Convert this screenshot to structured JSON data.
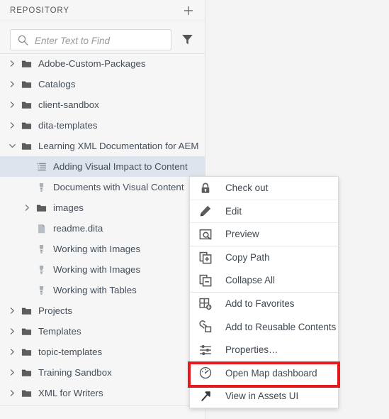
{
  "panel": {
    "title": "REPOSITORY",
    "add_icon": "plus-icon",
    "search": {
      "placeholder": "Enter Text to Find",
      "value": "",
      "icon": "search-icon"
    },
    "filter_icon": "filter-icon"
  },
  "tree": {
    "items": [
      {
        "label": "Adobe-Custom-Packages",
        "icon": "folder-icon",
        "twisty": "collapsed",
        "indent": 0,
        "selected": false
      },
      {
        "label": "Catalogs",
        "icon": "folder-icon",
        "twisty": "collapsed",
        "indent": 0,
        "selected": false
      },
      {
        "label": "client-sandbox",
        "icon": "folder-icon",
        "twisty": "collapsed",
        "indent": 0,
        "selected": false
      },
      {
        "label": "dita-templates",
        "icon": "folder-icon",
        "twisty": "collapsed",
        "indent": 0,
        "selected": false
      },
      {
        "label": "Learning XML Documentation for AEM",
        "icon": "folder-icon",
        "twisty": "expanded",
        "indent": 0,
        "selected": false
      },
      {
        "label": "Adding Visual Impact to Content",
        "icon": "ditamap-icon",
        "twisty": "none",
        "indent": 1,
        "selected": true
      },
      {
        "label": "Documents with Visual Content",
        "icon": "ditatopic-icon",
        "twisty": "none",
        "indent": 1,
        "selected": false
      },
      {
        "label": "images",
        "icon": "folder-icon",
        "twisty": "collapsed",
        "indent": 1,
        "selected": false
      },
      {
        "label": "readme.dita",
        "icon": "file-icon",
        "twisty": "none",
        "indent": 1,
        "selected": false
      },
      {
        "label": "Working with Images",
        "icon": "ditatopic-icon",
        "twisty": "none",
        "indent": 1,
        "selected": false
      },
      {
        "label": "Working with Images",
        "icon": "ditatopic-icon",
        "twisty": "none",
        "indent": 1,
        "selected": false
      },
      {
        "label": "Working with Tables",
        "icon": "ditatopic-icon",
        "twisty": "none",
        "indent": 1,
        "selected": false
      },
      {
        "label": "Projects",
        "icon": "folder-icon",
        "twisty": "collapsed",
        "indent": 0,
        "selected": false
      },
      {
        "label": "Templates",
        "icon": "folder-icon",
        "twisty": "collapsed",
        "indent": 0,
        "selected": false
      },
      {
        "label": "topic-templates",
        "icon": "folder-icon",
        "twisty": "collapsed",
        "indent": 0,
        "selected": false
      },
      {
        "label": "Training Sandbox",
        "icon": "folder-icon",
        "twisty": "collapsed",
        "indent": 0,
        "selected": false
      },
      {
        "label": "XML for Writers",
        "icon": "folder-icon",
        "twisty": "collapsed",
        "indent": 0,
        "selected": false
      }
    ]
  },
  "context_menu": {
    "items": [
      {
        "label": "Check out",
        "icon": "lock-icon",
        "separator_after": true
      },
      {
        "label": "Edit",
        "icon": "pencil-icon",
        "separator_after": true
      },
      {
        "label": "Preview",
        "icon": "preview-icon",
        "separator_after": true,
        "group_end": true
      },
      {
        "label": "Copy Path",
        "icon": "copy-path-icon",
        "separator_after": false
      },
      {
        "label": "Collapse All",
        "icon": "collapse-all-icon",
        "separator_after": false,
        "group_end": true
      },
      {
        "label": "Add to Favorites",
        "icon": "add-favorites-icon",
        "separator_after": false
      },
      {
        "label": "Add to Reusable Contents",
        "icon": "reusable-contents-icon",
        "separator_after": false
      },
      {
        "label": "Properties…",
        "icon": "properties-icon",
        "separator_after": false
      },
      {
        "label": "Open Map dashboard",
        "icon": "dashboard-icon",
        "separator_after": false,
        "highlighted": true
      },
      {
        "label": "View in Assets UI",
        "icon": "external-link-icon",
        "separator_after": false
      }
    ]
  },
  "colors": {
    "highlight_border": "#e8191b",
    "selection_background": "#dee4ed",
    "panel_background": "#f6f6f6",
    "canvas_background": "#f4f4f4",
    "menu_background": "#ffffff",
    "text": "#3f4750"
  }
}
